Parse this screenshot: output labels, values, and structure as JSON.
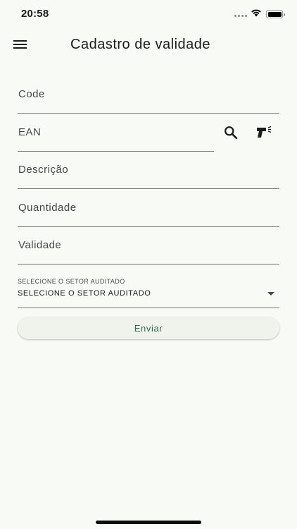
{
  "status_bar": {
    "time": "20:58",
    "icons": [
      "signal-dots-icon",
      "wifi-icon",
      "battery-icon"
    ]
  },
  "app_bar": {
    "title": "Cadastro de validade",
    "menu_icon": "hamburger-menu-icon"
  },
  "form": {
    "code": {
      "label": "Code",
      "value": ""
    },
    "ean": {
      "label": "EAN",
      "value": "",
      "search_icon": "search-icon",
      "scanner_icon": "barcode-scanner-icon"
    },
    "descricao": {
      "label": "Descrição",
      "value": ""
    },
    "quantidade": {
      "label": "Quantidade",
      "value": ""
    },
    "validade": {
      "label": "Validade",
      "value": ""
    },
    "setor": {
      "label": "SELECIONE O SETOR AUDITADO",
      "selected": "SELECIONE O SETOR AUDITADO"
    },
    "submit_label": "Enviar"
  },
  "colors": {
    "background": "#f8faf5",
    "accent": "#2f6e4e",
    "button_bg": "#eff3ec"
  }
}
